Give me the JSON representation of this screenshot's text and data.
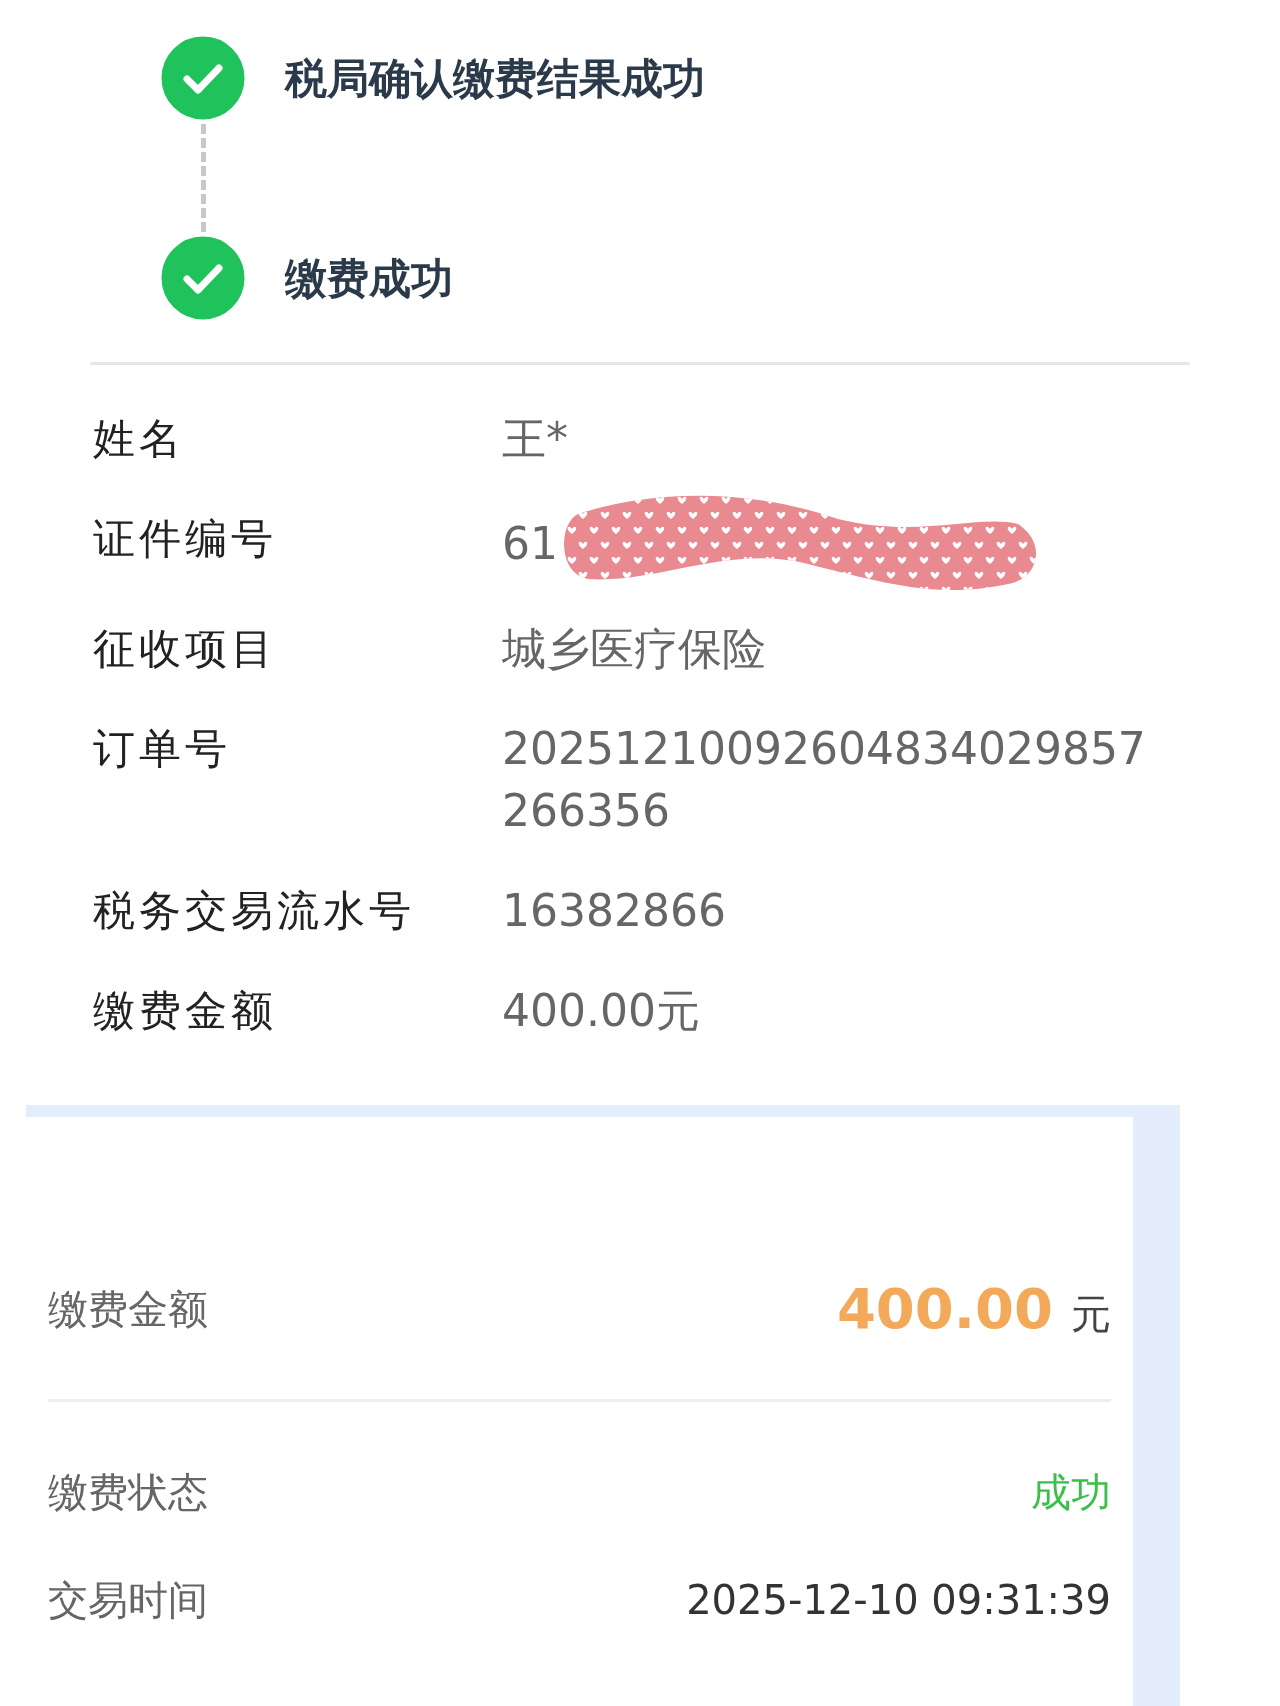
{
  "steps": [
    {
      "label": "税局确认缴费结果成功",
      "done": true
    },
    {
      "label": "缴费成功",
      "done": true
    }
  ],
  "details": [
    {
      "label": "姓名",
      "value": "王*",
      "redacted": false
    },
    {
      "label": "证件编号",
      "value": "61",
      "redacted": true
    },
    {
      "label": "征收项目",
      "value": "城乡医疗保险",
      "redacted": false
    },
    {
      "label": "订单号",
      "value": "20251210092604834029857266356",
      "redacted": false
    },
    {
      "label": "税务交易流水号",
      "value": "16382866",
      "redacted": false
    },
    {
      "label": "缴费金额",
      "value": "400.00元",
      "redacted": false
    }
  ],
  "summary": [
    {
      "kind": "amount",
      "label": "缴费金额",
      "value": "400.00",
      "unit": "元"
    },
    {
      "kind": "status",
      "label": "缴费状态",
      "value": "成功"
    },
    {
      "kind": "plain",
      "label": "交易时间",
      "value": "2025-12-10 09:31:39"
    }
  ]
}
